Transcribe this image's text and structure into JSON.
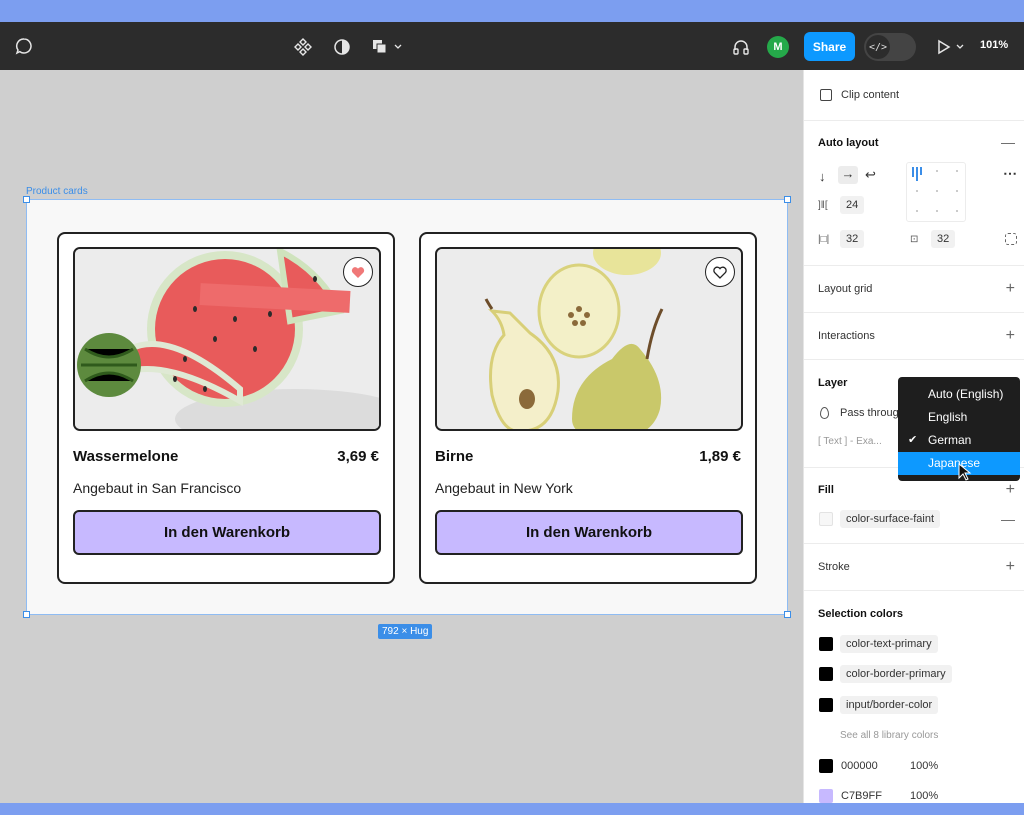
{
  "toolbar": {
    "share_label": "Share",
    "avatar_initial": "M",
    "zoom": "101%",
    "devmode_glyph": "</>"
  },
  "canvas": {
    "frame_label": "Product cards",
    "size_badge": "792 × Hug",
    "products": [
      {
        "name": "Wassermelone",
        "price": "3,69 €",
        "origin": "Angebaut in San Francisco",
        "cta": "In den Warenkorb",
        "favorited": true
      },
      {
        "name": "Birne",
        "price": "1,89 €",
        "origin": "Angebaut in New York",
        "cta": "In den Warenkorb",
        "favorited": false
      }
    ]
  },
  "panel": {
    "clip_content": "Clip content",
    "auto_layout": {
      "title": "Auto layout",
      "gap": "24",
      "padding_h": "32",
      "padding_v": "32"
    },
    "layout_grid": "Layout grid",
    "interactions": "Interactions",
    "layer": {
      "title": "Layer",
      "blend": "Pass throug",
      "text_row": "[ Text ] - Exa..."
    },
    "fill": {
      "title": "Fill",
      "token": "color-surface-faint"
    },
    "stroke": "Stroke",
    "selection_colors": {
      "title": "Selection colors",
      "tokens": [
        "color-text-primary",
        "color-border-primary",
        "input/border-color"
      ],
      "see_all": "See all 8 library colors",
      "raw": [
        {
          "hex": "000000",
          "opacity": "100%",
          "color": "#000000"
        },
        {
          "hex": "C7B9FF",
          "opacity": "100%",
          "color": "#C7B9FF"
        }
      ]
    }
  },
  "dropdown": {
    "items": [
      "Auto (English)",
      "English",
      "German",
      "Japanese"
    ],
    "checked": "German",
    "highlighted": "Japanese"
  },
  "colors": {
    "accent": "#0d99ff",
    "selection": "#3b8ee8",
    "button_fill": "#c7b9ff",
    "toolbar_bg": "#2c2c2c"
  }
}
